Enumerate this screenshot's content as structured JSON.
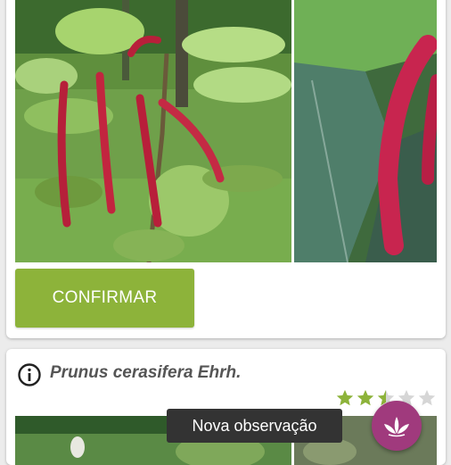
{
  "result_card": {
    "confirm_label": "CONFIRMAR",
    "photos": [
      "red-catkin-plant-photo",
      "red-catkin-closeup-photo"
    ]
  },
  "next_card": {
    "species_name": "Prunus cerasifera Ehrh.",
    "rating": 2.5,
    "rating_max": 5,
    "photos": [
      "plant-thumbnail-photo",
      "plant-thumbnail-photo-2"
    ]
  },
  "toast": {
    "text": "Nova observação"
  },
  "fab": {
    "icon": "leaf-icon"
  },
  "colors": {
    "accent_green": "#8db33a",
    "fab_purple": "#a03a7d",
    "star_filled": "#8db33a",
    "star_empty": "#d6d6d6"
  }
}
